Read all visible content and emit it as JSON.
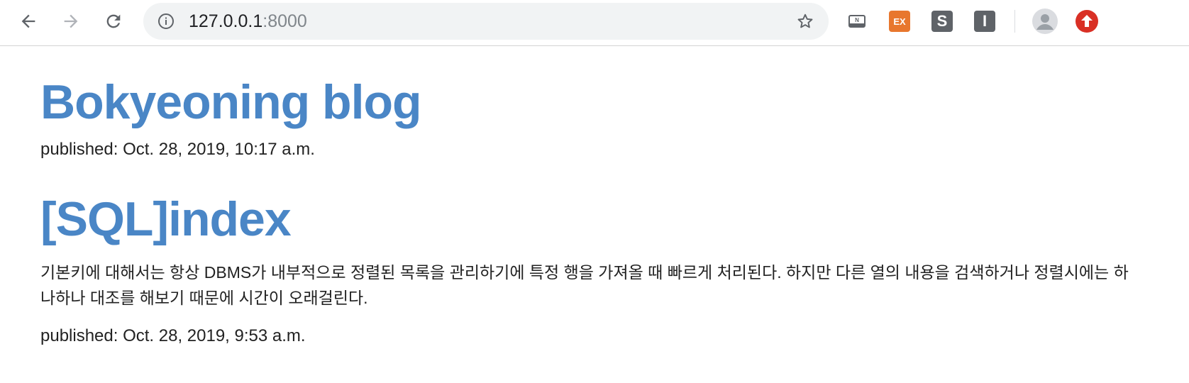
{
  "browser": {
    "url_host": "127.0.0.1",
    "url_port": ":8000",
    "extensions": [
      {
        "name": "notion-web-clipper",
        "label": "N"
      },
      {
        "name": "ex-extension",
        "label": "EX",
        "color": "#e8772e"
      },
      {
        "name": "s-extension",
        "label": "S",
        "color": "#5f6368"
      },
      {
        "name": "i-extension",
        "label": "I",
        "color": "#5f6368"
      }
    ],
    "update_color": "#d93025"
  },
  "posts": [
    {
      "title": "Bokyeoning blog",
      "published": "published: Oct. 28, 2019, 10:17 a.m."
    },
    {
      "title": "[SQL]index",
      "body": "기본키에 대해서는 항상 DBMS가 내부적으로 정렬된 목록을 관리하기에 특정 행을 가져올 때 빠르게 처리된다. 하지만 다른 열의 내용을 검색하거나 정렬시에는 하나하나 대조를 해보기 때문에 시간이 오래걸린다.",
      "published": "published: Oct. 28, 2019, 9:53 a.m."
    }
  ],
  "colors": {
    "link": "#4a86c6",
    "text": "#222222"
  }
}
